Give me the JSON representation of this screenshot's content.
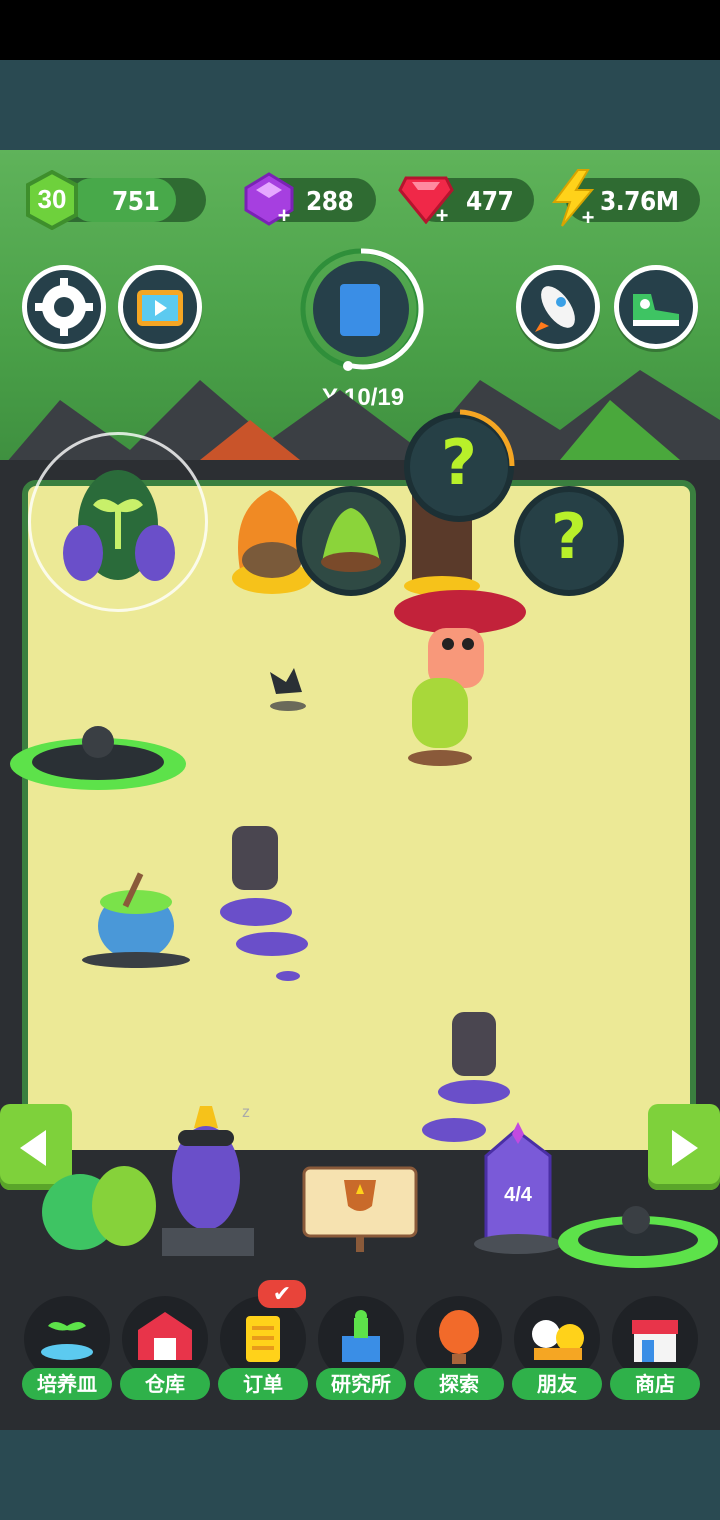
{
  "hud": {
    "level": "30",
    "xp": "751",
    "gems": "288",
    "rubies": "477",
    "energy": "3.76M",
    "seed_progress": "10/19"
  },
  "buttons": {
    "settings_icon": "gear-icon",
    "video_icon": "tv-play-icon",
    "book_icon": "plant-book-icon",
    "rocket_icon": "rocket-icon",
    "shoe_icon": "sneaker-icon"
  },
  "field": {
    "unknown_plant_1": "?",
    "unknown_plant_2": "?",
    "crystal_counter": "4/4"
  },
  "nav": {
    "items": [
      {
        "label": "培养皿",
        "icon": "petri-dish-icon"
      },
      {
        "label": "仓库",
        "icon": "barn-icon"
      },
      {
        "label": "订单",
        "icon": "order-scroll-icon"
      },
      {
        "label": "研究所",
        "icon": "lab-icon"
      },
      {
        "label": "探索",
        "icon": "balloon-icon"
      },
      {
        "label": "朋友",
        "icon": "friends-icon"
      },
      {
        "label": "商店",
        "icon": "shop-icon"
      }
    ]
  },
  "colors": {
    "accent_green": "#2fb14a",
    "field": "#ece996",
    "slime": "#5de24a",
    "purple": "#6a4fc9"
  }
}
